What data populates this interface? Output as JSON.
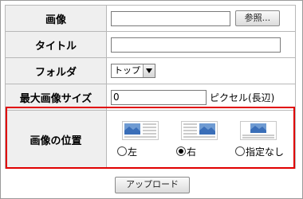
{
  "form": {
    "rows": [
      {
        "label": "画像",
        "button_label": "参照..."
      },
      {
        "label": "タイトル"
      },
      {
        "label": "フォルダ",
        "select_value": "トップ"
      },
      {
        "label": "最大画像サイズ",
        "input_value": "0",
        "unit": "ピクセル(長辺)"
      },
      {
        "label": "画像の位置"
      }
    ],
    "positions": [
      {
        "label": "左",
        "icon": "image-left-icon",
        "selected": false
      },
      {
        "label": "右",
        "icon": "image-right-icon",
        "selected": true
      },
      {
        "label": "指定なし",
        "icon": "image-none-icon",
        "selected": false
      }
    ],
    "upload_label": "アップロード"
  },
  "colors": {
    "label_bg": "#efefef",
    "border": "#b8b8b8",
    "highlight": "#e00000"
  }
}
